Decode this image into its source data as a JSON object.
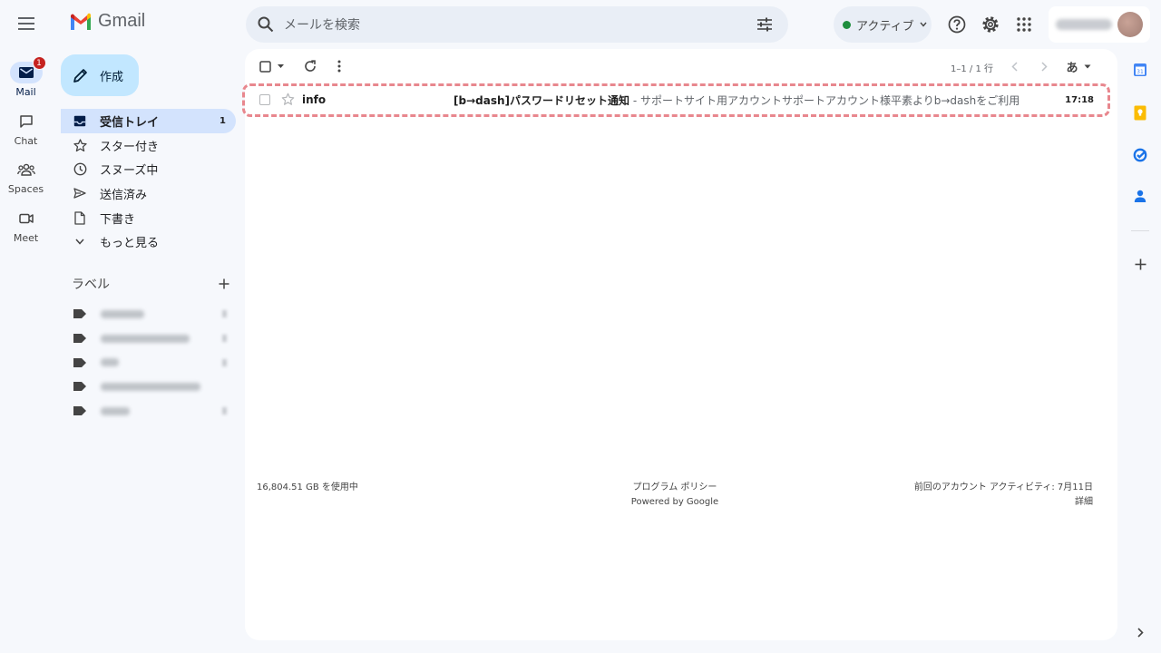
{
  "app": {
    "name": "Gmail"
  },
  "search": {
    "placeholder": "メールを検索"
  },
  "status": {
    "label": "アクティブ"
  },
  "rail": [
    {
      "label": "Mail",
      "badge": "1"
    },
    {
      "label": "Chat"
    },
    {
      "label": "Spaces"
    },
    {
      "label": "Meet"
    }
  ],
  "compose": {
    "label": "作成"
  },
  "nav": [
    {
      "label": "受信トレイ",
      "count": "1"
    },
    {
      "label": "スター付き"
    },
    {
      "label": "スヌーズ中"
    },
    {
      "label": "送信済み"
    },
    {
      "label": "下書き"
    },
    {
      "label": "もっと見る"
    }
  ],
  "labels": {
    "heading": "ラベル"
  },
  "toolbar": {
    "pager": "1–1 / 1 行",
    "input_tool": "あ"
  },
  "email": {
    "sender": "info",
    "subject": "[b→dash]パスワードリセット通知",
    "snippet": " - サポートサイト用アカウントサポートアカウント様平素よりb→dashをご利用い...",
    "time": "17:18"
  },
  "footer": {
    "storage": "16,804.51 GB を使用中",
    "policy": "プログラム ポリシー",
    "powered": "Powered by Google",
    "last_activity": "前回のアカウント アクティビティ: 7月11日",
    "details": "詳細"
  },
  "colors": {
    "accent": "#d3e3fd",
    "compose": "#c2e7ff",
    "badge": "#c5221f",
    "active_dot": "#1e8e3e",
    "highlight": "#e8878e"
  }
}
